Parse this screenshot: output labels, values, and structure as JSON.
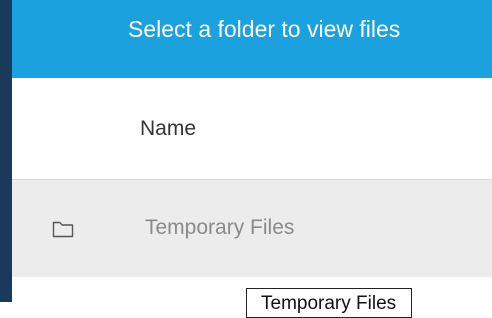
{
  "header": {
    "title": "Select a folder to view files",
    "color": "#1ba1dd"
  },
  "table": {
    "columns": [
      {
        "label": "Name"
      }
    ],
    "rows": [
      {
        "icon": "folder-icon",
        "name": "Temporary Files"
      }
    ]
  },
  "tooltip": {
    "text": "Temporary Files"
  }
}
